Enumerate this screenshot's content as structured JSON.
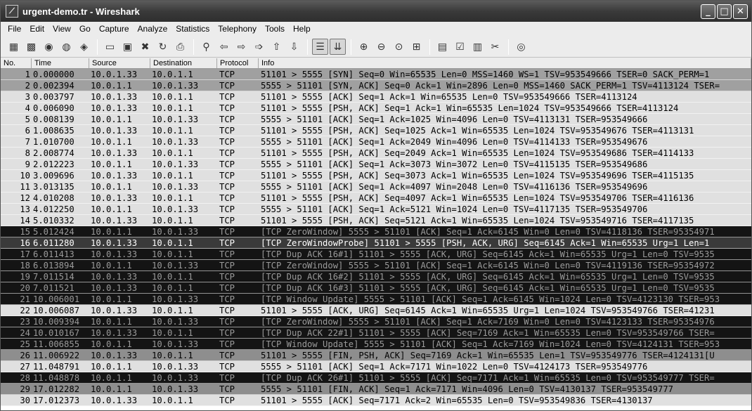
{
  "window": {
    "title": "urgent-demo.tr - Wireshark"
  },
  "menubar": {
    "items": [
      "File",
      "Edit",
      "View",
      "Go",
      "Capture",
      "Analyze",
      "Statistics",
      "Telephony",
      "Tools",
      "Help"
    ]
  },
  "toolbar": {
    "icons": [
      "interface-list-icon",
      "capture-options-icon",
      "start-capture-icon",
      "stop-capture-icon",
      "restart-capture-icon",
      "open-file-icon",
      "save-file-icon",
      "close-file-icon",
      "reload-icon",
      "print-icon",
      "find-packet-icon",
      "go-back-icon",
      "go-forward-icon",
      "go-to-packet-icon",
      "go-first-icon",
      "go-last-icon",
      "colorize-icon",
      "autoscroll-icon",
      "zoom-in-icon",
      "zoom-out-icon",
      "normal-size-icon",
      "resize-columns-icon",
      "capture-filters-icon",
      "display-filters-icon",
      "coloring-rules-icon",
      "preferences-icon",
      "help-icon"
    ]
  },
  "packet_list": {
    "columns": [
      "No.",
      "Time",
      "Source",
      "Destination",
      "Protocol",
      "Info"
    ],
    "rows": [
      {
        "no": "1",
        "time": "0.000000",
        "src": "10.0.1.33",
        "dst": "10.0.1.1",
        "proto": "TCP",
        "info": "51101 > 5555 [SYN] Seq=0 Win=65535 Len=0 MSS=1460 WS=1 TSV=953549666 TSER=0 SACK_PERM=1",
        "tone": "dark"
      },
      {
        "no": "2",
        "time": "0.002394",
        "src": "10.0.1.1",
        "dst": "10.0.1.33",
        "proto": "TCP",
        "info": "5555 > 51101 [SYN, ACK] Seq=0 Ack=1 Win=2896 Len=0 MSS=1460 SACK_PERM=1 TSV=4113124 TSER=",
        "tone": "dark"
      },
      {
        "no": "3",
        "time": "0.003797",
        "src": "10.0.1.33",
        "dst": "10.0.1.1",
        "proto": "TCP",
        "info": "51101 > 5555 [ACK] Seq=1 Ack=1 Win=65535 Len=0 TSV=953549666 TSER=4113124",
        "tone": "gray"
      },
      {
        "no": "4",
        "time": "0.006090",
        "src": "10.0.1.33",
        "dst": "10.0.1.1",
        "proto": "TCP",
        "info": "51101 > 5555 [PSH, ACK] Seq=1 Ack=1 Win=65535 Len=1024 TSV=953549666 TSER=4113124",
        "tone": "gray"
      },
      {
        "no": "5",
        "time": "0.008139",
        "src": "10.0.1.1",
        "dst": "10.0.1.33",
        "proto": "TCP",
        "info": "5555 > 51101 [ACK] Seq=1 Ack=1025 Win=4096 Len=0 TSV=4113131 TSER=953549666",
        "tone": "gray"
      },
      {
        "no": "6",
        "time": "1.008635",
        "src": "10.0.1.33",
        "dst": "10.0.1.1",
        "proto": "TCP",
        "info": "51101 > 5555 [PSH, ACK] Seq=1025 Ack=1 Win=65535 Len=1024 TSV=953549676 TSER=4113131",
        "tone": "gray"
      },
      {
        "no": "7",
        "time": "1.010700",
        "src": "10.0.1.1",
        "dst": "10.0.1.33",
        "proto": "TCP",
        "info": "5555 > 51101 [ACK] Seq=1 Ack=2049 Win=4096 Len=0 TSV=4114133 TSER=953549676",
        "tone": "gray"
      },
      {
        "no": "8",
        "time": "2.008774",
        "src": "10.0.1.33",
        "dst": "10.0.1.1",
        "proto": "TCP",
        "info": "51101 > 5555 [PSH, ACK] Seq=2049 Ack=1 Win=65535 Len=1024 TSV=953549686 TSER=4114133",
        "tone": "gray"
      },
      {
        "no": "9",
        "time": "2.012223",
        "src": "10.0.1.1",
        "dst": "10.0.1.33",
        "proto": "TCP",
        "info": "5555 > 51101 [ACK] Seq=1 Ack=3073 Win=3072 Len=0 TSV=4115135 TSER=953549686",
        "tone": "gray"
      },
      {
        "no": "10",
        "time": "3.009696",
        "src": "10.0.1.33",
        "dst": "10.0.1.1",
        "proto": "TCP",
        "info": "51101 > 5555 [PSH, ACK] Seq=3073 Ack=1 Win=65535 Len=1024 TSV=953549696 TSER=4115135",
        "tone": "gray"
      },
      {
        "no": "11",
        "time": "3.013135",
        "src": "10.0.1.1",
        "dst": "10.0.1.33",
        "proto": "TCP",
        "info": "5555 > 51101 [ACK] Seq=1 Ack=4097 Win=2048 Len=0 TSV=4116136 TSER=953549696",
        "tone": "gray"
      },
      {
        "no": "12",
        "time": "4.010208",
        "src": "10.0.1.33",
        "dst": "10.0.1.1",
        "proto": "TCP",
        "info": "51101 > 5555 [PSH, ACK] Seq=4097 Ack=1 Win=65535 Len=1024 TSV=953549706 TSER=4116136",
        "tone": "gray"
      },
      {
        "no": "13",
        "time": "4.012250",
        "src": "10.0.1.1",
        "dst": "10.0.1.33",
        "proto": "TCP",
        "info": "5555 > 51101 [ACK] Seq=1 Ack=5121 Win=1024 Len=0 TSV=4117135 TSER=953549706",
        "tone": "gray"
      },
      {
        "no": "14",
        "time": "5.010332",
        "src": "10.0.1.33",
        "dst": "10.0.1.1",
        "proto": "TCP",
        "info": "51101 > 5555 [PSH, ACK] Seq=5121 Ack=1 Win=65535 Len=1024 TSV=953549716 TSER=4117135",
        "tone": "gray"
      },
      {
        "no": "15",
        "time": "5.012424",
        "src": "10.0.1.1",
        "dst": "10.0.1.33",
        "proto": "TCP",
        "info": "[TCP ZeroWindow] 5555 > 51101 [ACK] Seq=1 Ack=6145 Win=0 Len=0 TSV=4118136 TSER=95354971",
        "tone": "black"
      },
      {
        "no": "16",
        "time": "6.011280",
        "src": "10.0.1.33",
        "dst": "10.0.1.1",
        "proto": "TCP",
        "info": "[TCP ZeroWindowProbe] 51101 > 5555 [PSH, ACK, URG] Seq=6145 Ack=1 Win=65535 Urg=1 Len=1",
        "tone": "selected"
      },
      {
        "no": "17",
        "time": "6.011413",
        "src": "10.0.1.33",
        "dst": "10.0.1.1",
        "proto": "TCP",
        "info": "[TCP Dup ACK 16#1] 51101 > 5555 [ACK, URG] Seq=6145 Ack=1 Win=65535 Urg=1 Len=0 TSV=9535",
        "tone": "black"
      },
      {
        "no": "18",
        "time": "6.013894",
        "src": "10.0.1.1",
        "dst": "10.0.1.33",
        "proto": "TCP",
        "info": "[TCP ZeroWindow] 5555 > 51101 [ACK] Seq=1 Ack=6145 Win=0 Len=0 TSV=4119136 TSER=95354972",
        "tone": "black"
      },
      {
        "no": "19",
        "time": "7.011514",
        "src": "10.0.1.33",
        "dst": "10.0.1.1",
        "proto": "TCP",
        "info": "[TCP Dup ACK 16#2] 51101 > 5555 [ACK, URG] Seq=6145 Ack=1 Win=65535 Urg=1 Len=0 TSV=9535",
        "tone": "black"
      },
      {
        "no": "20",
        "time": "7.011521",
        "src": "10.0.1.33",
        "dst": "10.0.1.1",
        "proto": "TCP",
        "info": "[TCP Dup ACK 16#3] 51101 > 5555 [ACK, URG] Seq=6145 Ack=1 Win=65535 Urg=1 Len=0 TSV=9535",
        "tone": "black"
      },
      {
        "no": "21",
        "time": "10.006001",
        "src": "10.0.1.1",
        "dst": "10.0.1.33",
        "proto": "TCP",
        "info": "[TCP Window Update] 5555 > 51101 [ACK] Seq=1 Ack=6145 Win=1024 Len=0 TSV=4123130 TSER=953",
        "tone": "black"
      },
      {
        "no": "22",
        "time": "10.006087",
        "src": "10.0.1.33",
        "dst": "10.0.1.1",
        "proto": "TCP",
        "info": "51101 > 5555 [ACK, URG] Seq=6145 Ack=1 Win=65535 Urg=1 Len=1024 TSV=953549766 TSER=41231",
        "tone": "gray"
      },
      {
        "no": "23",
        "time": "10.009394",
        "src": "10.0.1.1",
        "dst": "10.0.1.33",
        "proto": "TCP",
        "info": "[TCP ZeroWindow] 5555 > 51101 [ACK] Seq=1 Ack=7169 Win=0 Len=0 TSV=4123133 TSER=95354976",
        "tone": "black"
      },
      {
        "no": "24",
        "time": "10.010167",
        "src": "10.0.1.33",
        "dst": "10.0.1.1",
        "proto": "TCP",
        "info": "[TCP Dup ACK 22#1] 51101 > 5555 [ACK] Seq=7169 Ack=1 Win=65535 Len=0 TSV=953549766 TSER=",
        "tone": "black"
      },
      {
        "no": "25",
        "time": "11.006855",
        "src": "10.0.1.1",
        "dst": "10.0.1.33",
        "proto": "TCP",
        "info": "[TCP Window Update] 5555 > 51101 [ACK] Seq=1 Ack=7169 Win=1024 Len=0 TSV=4124131 TSER=953",
        "tone": "black"
      },
      {
        "no": "26",
        "time": "11.006922",
        "src": "10.0.1.33",
        "dst": "10.0.1.1",
        "proto": "TCP",
        "info": "51101 > 5555 [FIN, PSH, ACK] Seq=7169 Ack=1 Win=65535 Len=1 TSV=953549776 TSER=4124131[U",
        "tone": "mid"
      },
      {
        "no": "27",
        "time": "11.048791",
        "src": "10.0.1.1",
        "dst": "10.0.1.33",
        "proto": "TCP",
        "info": "5555 > 51101 [ACK] Seq=1 Ack=7171 Win=1022 Len=0 TSV=4124173 TSER=953549776",
        "tone": "gray"
      },
      {
        "no": "28",
        "time": "11.048878",
        "src": "10.0.1.1",
        "dst": "10.0.1.33",
        "proto": "TCP",
        "info": "[TCP Dup ACK 26#1] 51101 > 5555 [ACK] Seq=7171 Ack=1 Win=65535 Len=0 TSV=953549777 TSER=",
        "tone": "black"
      },
      {
        "no": "29",
        "time": "17.012282",
        "src": "10.0.1.1",
        "dst": "10.0.1.33",
        "proto": "TCP",
        "info": "5555 > 51101 [FIN, ACK] Seq=1 Ack=7171 Win=4096 Len=0 TSV=4130137 TSER=953549777",
        "tone": "mid"
      },
      {
        "no": "30",
        "time": "17.012373",
        "src": "10.0.1.33",
        "dst": "10.0.1.1",
        "proto": "TCP",
        "info": "51101 > 5555 [ACK] Seq=7171 Ack=2 Win=65535 Len=0 TSV=953549836 TSER=4130137",
        "tone": "gray"
      }
    ]
  }
}
